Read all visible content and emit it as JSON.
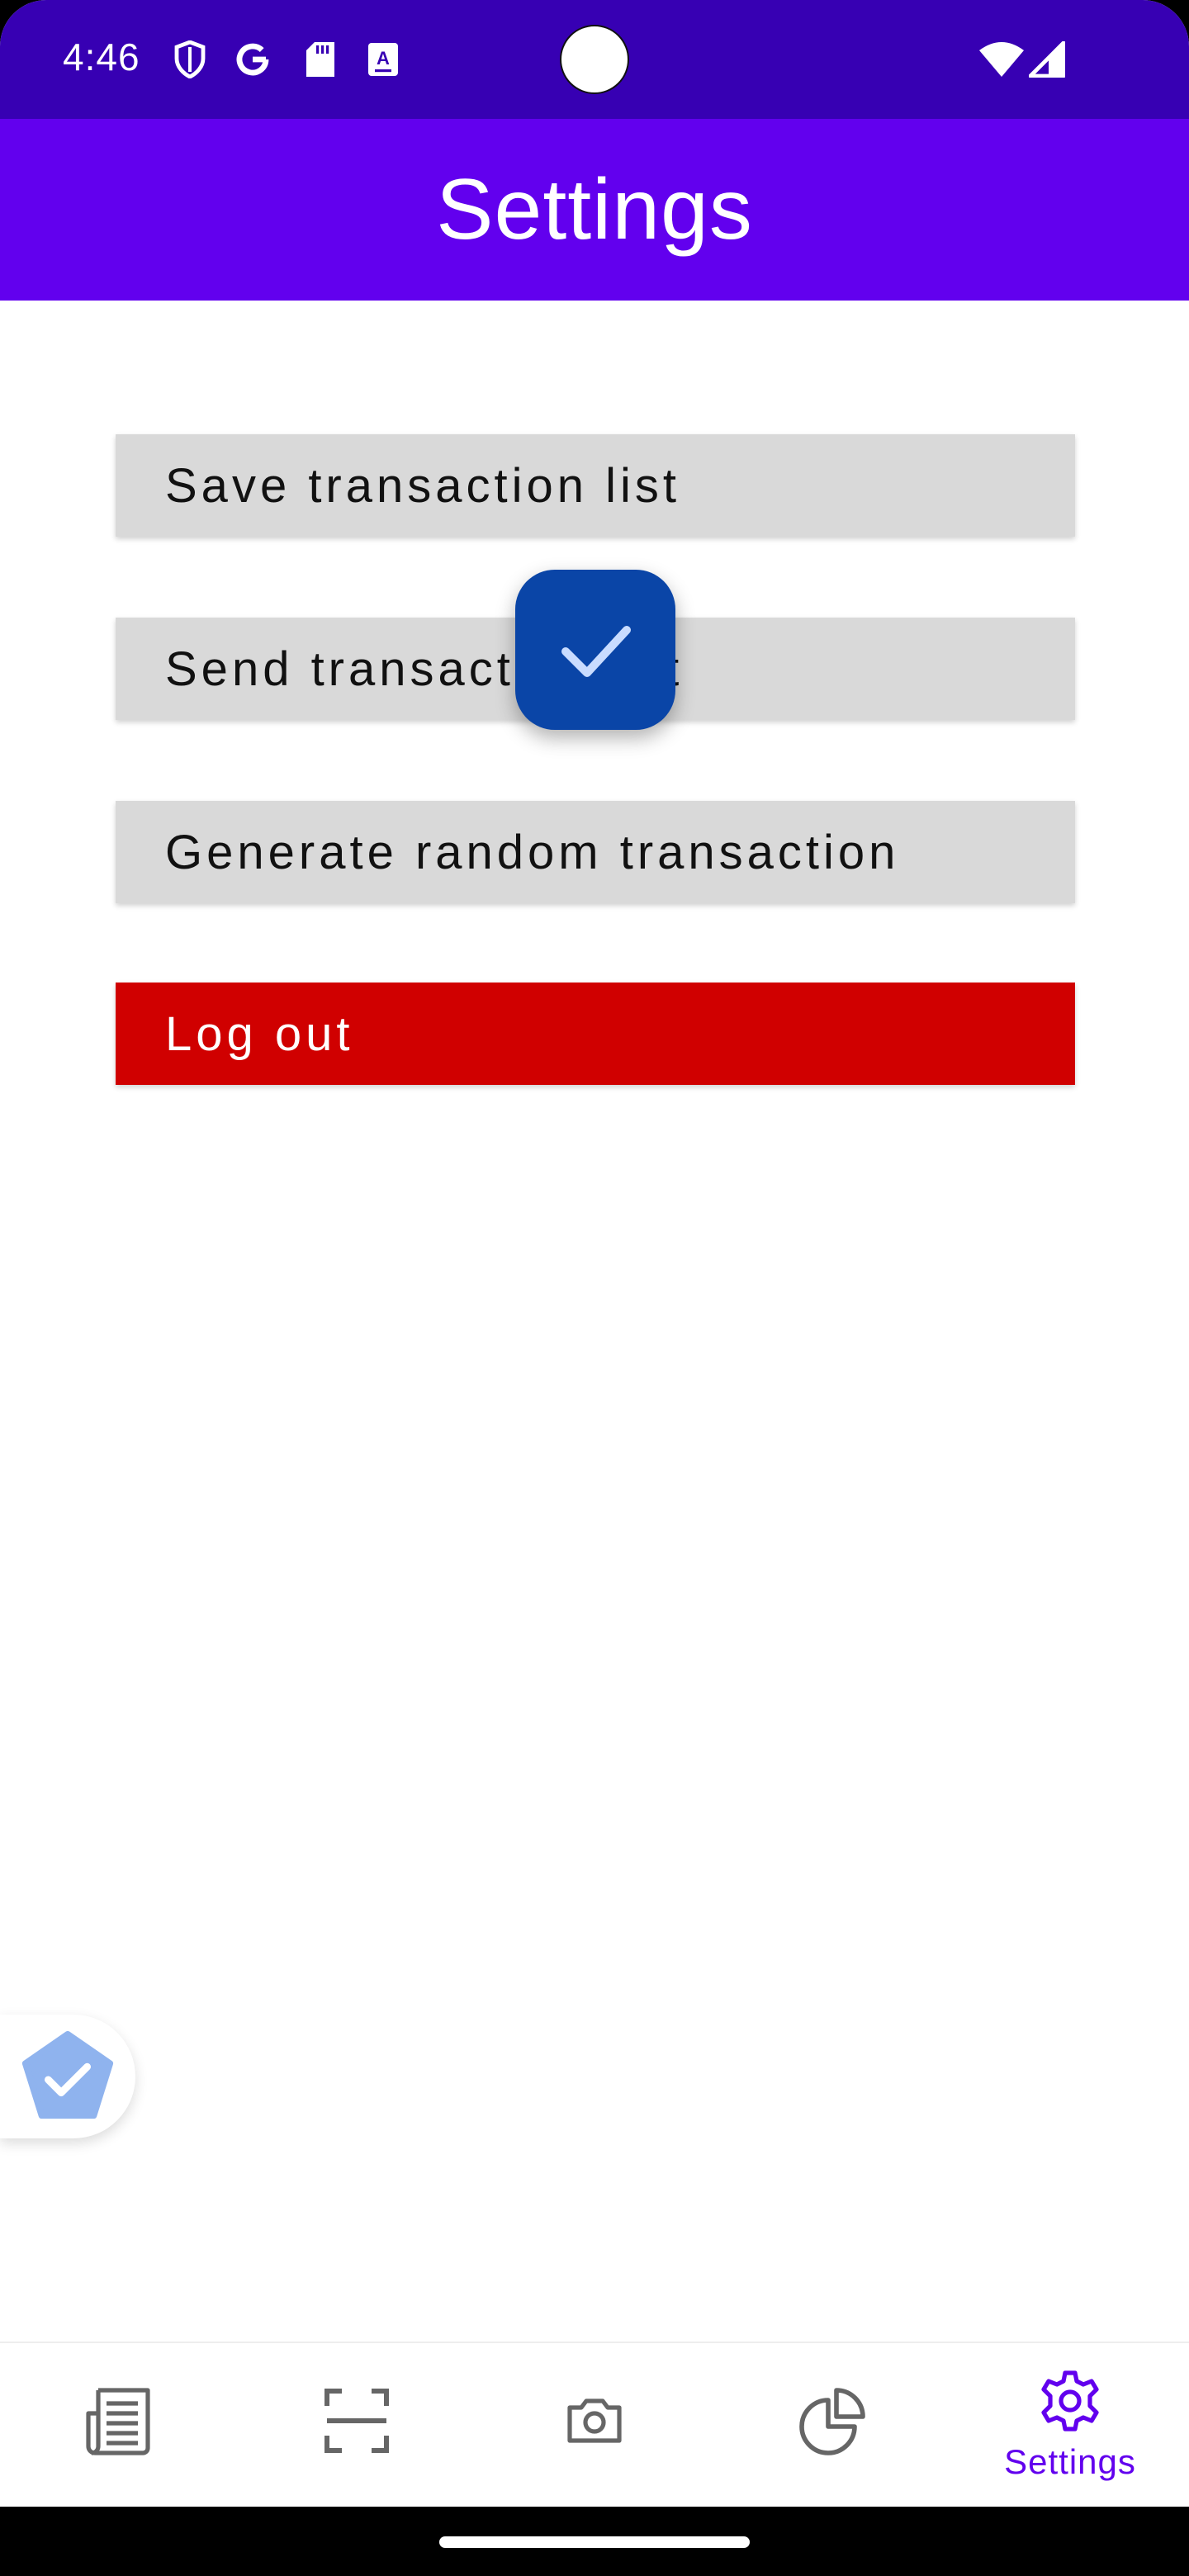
{
  "status_bar": {
    "time": "4:46",
    "icons": [
      "shield-icon",
      "google-icon",
      "sd-card-icon",
      "keyboard-a-icon",
      "wifi-icon",
      "signal-icon"
    ]
  },
  "app_bar": {
    "title": "Settings"
  },
  "actions": {
    "save": "Save transaction list",
    "send": "Send transaction list",
    "generate": "Generate random transaction",
    "logout": "Log out"
  },
  "bottom_nav": {
    "items": [
      {
        "icon": "list-icon",
        "label": ""
      },
      {
        "icon": "scan-icon",
        "label": ""
      },
      {
        "icon": "camera-icon",
        "label": ""
      },
      {
        "icon": "pie-chart-icon",
        "label": ""
      },
      {
        "icon": "gear-icon",
        "label": "Settings"
      }
    ],
    "selected": 4
  },
  "colors": {
    "status_bar": "#3700b3",
    "primary": "#6200ee",
    "button_bg": "#d9d9d9",
    "logout_bg": "#d00000",
    "fab": "#0a45a7"
  }
}
